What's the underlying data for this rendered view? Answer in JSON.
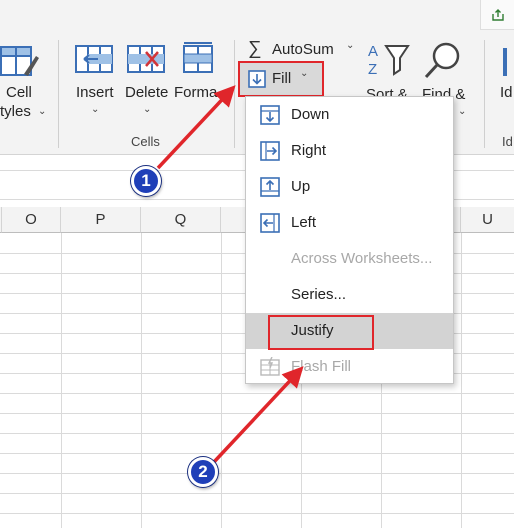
{
  "ribbon": {
    "cell_styles_line1": "Cell",
    "cell_styles_line2": "tyles",
    "insert": "Insert",
    "delete": "Delete",
    "format": "Forma",
    "cells_group": "Cells",
    "autosum": "AutoSum",
    "fill": "Fill",
    "sort_filter": "Sort &",
    "find_select_line1": "Find &",
    "ideas": "Id",
    "ideas_group": "Id"
  },
  "columns": [
    "O",
    "P",
    "Q",
    "U"
  ],
  "fill_menu": {
    "items": [
      {
        "label": "Down",
        "icon": "fill-down-icon",
        "enabled": true
      },
      {
        "label": "Right",
        "icon": "fill-right-icon",
        "enabled": true
      },
      {
        "label": "Up",
        "icon": "fill-up-icon",
        "enabled": true
      },
      {
        "label": "Left",
        "icon": "fill-left-icon",
        "enabled": true
      },
      {
        "label": "Across Worksheets...",
        "icon": "",
        "enabled": false
      },
      {
        "label": "Series...",
        "icon": "",
        "enabled": true
      },
      {
        "label": "Justify",
        "icon": "",
        "enabled": true,
        "highlighted": true
      },
      {
        "label": "Flash Fill",
        "icon": "flash-fill-icon",
        "enabled": false
      }
    ]
  },
  "annotations": {
    "step1": "1",
    "step2": "2",
    "highlight_color": "#e0262b",
    "badge_color": "#1f3fb8"
  }
}
